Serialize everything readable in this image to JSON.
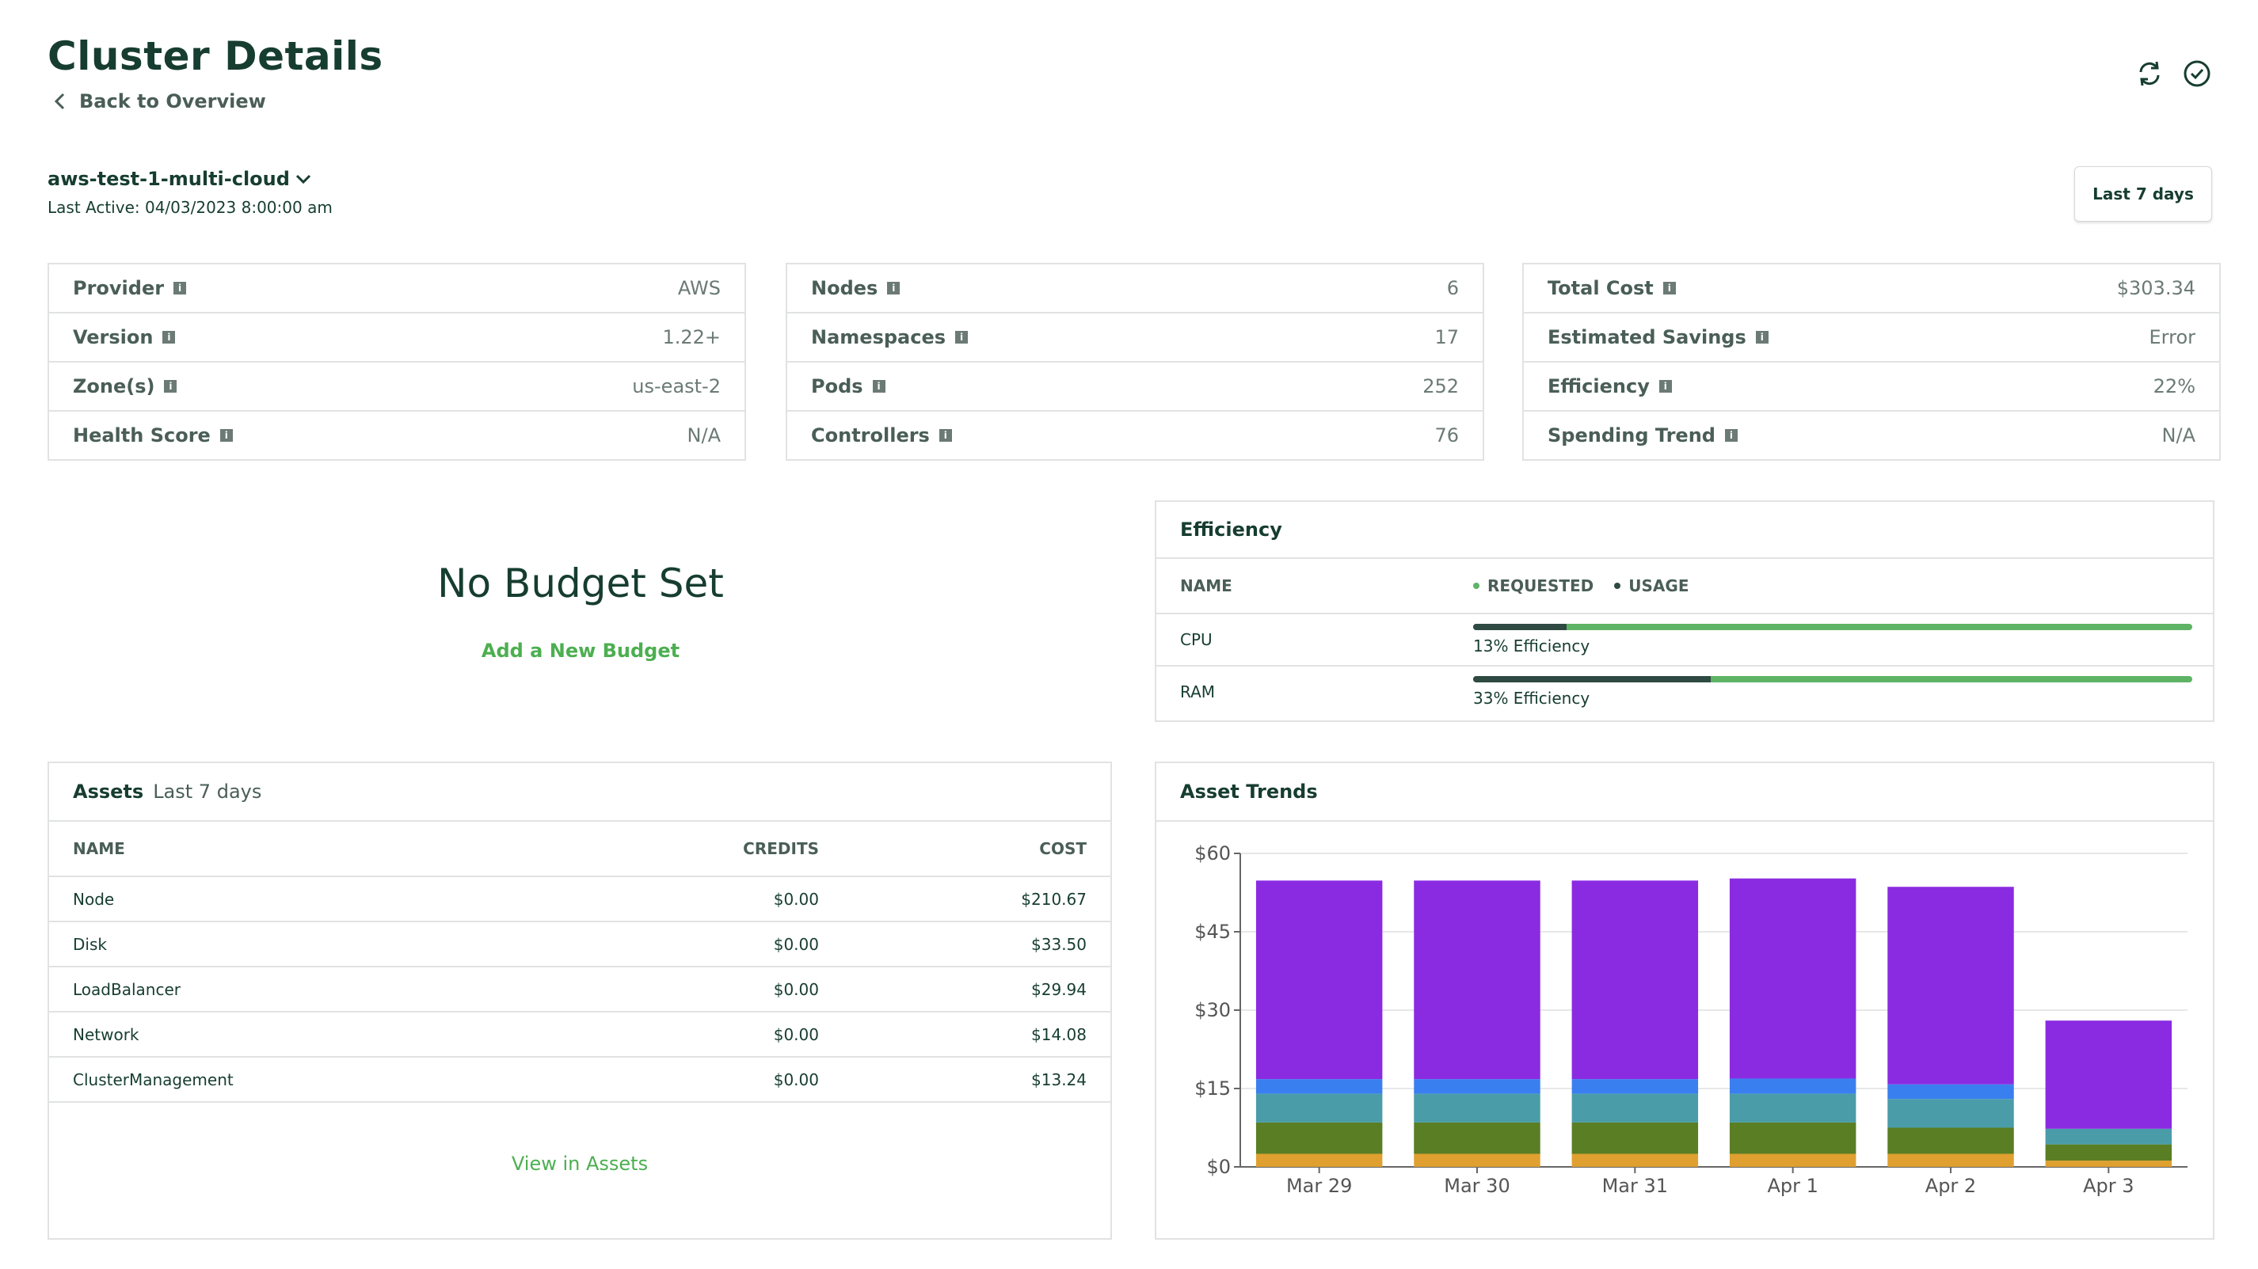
{
  "header": {
    "title": "Cluster Details",
    "back_label": "Back to Overview"
  },
  "cluster": {
    "name": "aws-test-1-multi-cloud",
    "last_active": "Last Active: 04/03/2023 8:00:00 am",
    "range_label": "Last 7 days"
  },
  "info": {
    "left": [
      {
        "label": "Provider",
        "value": "AWS"
      },
      {
        "label": "Version",
        "value": "1.22+"
      },
      {
        "label": "Zone(s)",
        "value": "us-east-2"
      },
      {
        "label": "Health Score",
        "value": "N/A"
      }
    ],
    "middle": [
      {
        "label": "Nodes",
        "value": "6"
      },
      {
        "label": "Namespaces",
        "value": "17"
      },
      {
        "label": "Pods",
        "value": "252"
      },
      {
        "label": "Controllers",
        "value": "76"
      }
    ],
    "right": [
      {
        "label": "Total Cost",
        "value": "$303.34"
      },
      {
        "label": "Estimated Savings",
        "value": "Error"
      },
      {
        "label": "Efficiency",
        "value": "22%"
      },
      {
        "label": "Spending Trend",
        "value": "N/A"
      }
    ],
    "icon_glyph": "i"
  },
  "budget": {
    "title": "No Budget Set",
    "add_label": "Add a New Budget"
  },
  "efficiency": {
    "title": "Efficiency",
    "name_header": "NAME",
    "legend_requested": "REQUESTED",
    "legend_usage": "USAGE",
    "colors": {
      "requested": "#5eb365",
      "usage": "#2f4a42"
    },
    "rows": [
      {
        "name": "CPU",
        "text": "13% Efficiency",
        "percent": 13
      },
      {
        "name": "RAM",
        "text": "33% Efficiency",
        "percent": 33
      }
    ]
  },
  "assets": {
    "title": "Assets",
    "subtitle": "Last 7 days",
    "columns": {
      "name": "NAME",
      "credits": "CREDITS",
      "cost": "COST"
    },
    "rows": [
      {
        "name": "Node",
        "credits": "$0.00",
        "cost": "$210.67"
      },
      {
        "name": "Disk",
        "credits": "$0.00",
        "cost": "$33.50"
      },
      {
        "name": "LoadBalancer",
        "credits": "$0.00",
        "cost": "$29.94"
      },
      {
        "name": "Network",
        "credits": "$0.00",
        "cost": "$14.08"
      },
      {
        "name": "ClusterManagement",
        "credits": "$0.00",
        "cost": "$13.24"
      }
    ],
    "view_label": "View in Assets"
  },
  "trends": {
    "title": "Asset Trends"
  },
  "chart_data": {
    "type": "bar",
    "stacked": true,
    "title": "Asset Trends",
    "categories": [
      "Mar 29",
      "Mar 30",
      "Mar 31",
      "Apr 1",
      "Apr 2",
      "Apr 3"
    ],
    "ylim": [
      0,
      60
    ],
    "yticks": [
      "$0",
      "$15",
      "$30",
      "$45",
      "$60"
    ],
    "ytick_values": [
      0,
      15,
      30,
      45,
      60
    ],
    "series": [
      {
        "color": "#e0a030",
        "values": [
          2.5,
          2.5,
          2.5,
          2.5,
          2.5,
          1.2
        ]
      },
      {
        "color": "#5a7e23",
        "values": [
          6,
          6,
          6,
          6,
          5,
          3.1
        ]
      },
      {
        "color": "#4a9da8",
        "values": [
          5.5,
          5.5,
          5.5,
          5.5,
          5.5,
          3
        ]
      },
      {
        "color": "#3a7ff0",
        "values": [
          2.8,
          2.8,
          2.8,
          2.9,
          2.8,
          0
        ]
      },
      {
        "color": "#8a2be2",
        "values": [
          38,
          38,
          38,
          38.3,
          37.8,
          20.7
        ]
      }
    ],
    "grid": true
  }
}
